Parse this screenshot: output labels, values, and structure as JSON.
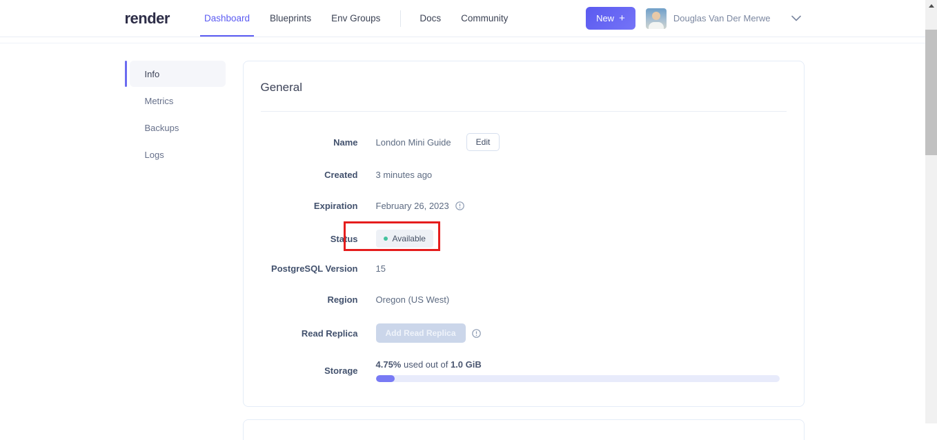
{
  "header": {
    "logo": "render",
    "nav": [
      {
        "label": "Dashboard",
        "active": true
      },
      {
        "label": "Blueprints",
        "active": false
      },
      {
        "label": "Env Groups",
        "active": false
      },
      {
        "label": "Docs",
        "active": false
      },
      {
        "label": "Community",
        "active": false
      }
    ],
    "new_button_label": "New",
    "new_button_plus": "+",
    "user_name": "Douglas Van Der Merwe"
  },
  "sidebar": {
    "items": [
      {
        "label": "Info",
        "active": true
      },
      {
        "label": "Metrics",
        "active": false
      },
      {
        "label": "Backups",
        "active": false
      },
      {
        "label": "Logs",
        "active": false
      }
    ]
  },
  "card": {
    "title": "General",
    "rows": {
      "name": {
        "label": "Name",
        "value": "London Mini Guide",
        "edit_button": "Edit"
      },
      "created": {
        "label": "Created",
        "value": "3 minutes ago"
      },
      "expiration": {
        "label": "Expiration",
        "value": "February 26, 2023"
      },
      "status": {
        "label": "Status",
        "badge": "Available"
      },
      "postgresql_version": {
        "label": "PostgreSQL Version",
        "value": "15"
      },
      "region": {
        "label": "Region",
        "value": "Oregon (US West)"
      },
      "read_replica": {
        "label": "Read Replica",
        "button": "Add Read Replica"
      },
      "storage": {
        "label": "Storage",
        "used_percent_text": "4.75%",
        "middle_text": " used out of ",
        "total_text": "1.0 GiB",
        "progress_percent": 4.75
      }
    }
  },
  "colors": {
    "accent": "#5b5bf2",
    "status_dot_green": "#44c29e",
    "annotation_red": "#e51d1d",
    "progress_fill": "#787af4"
  }
}
